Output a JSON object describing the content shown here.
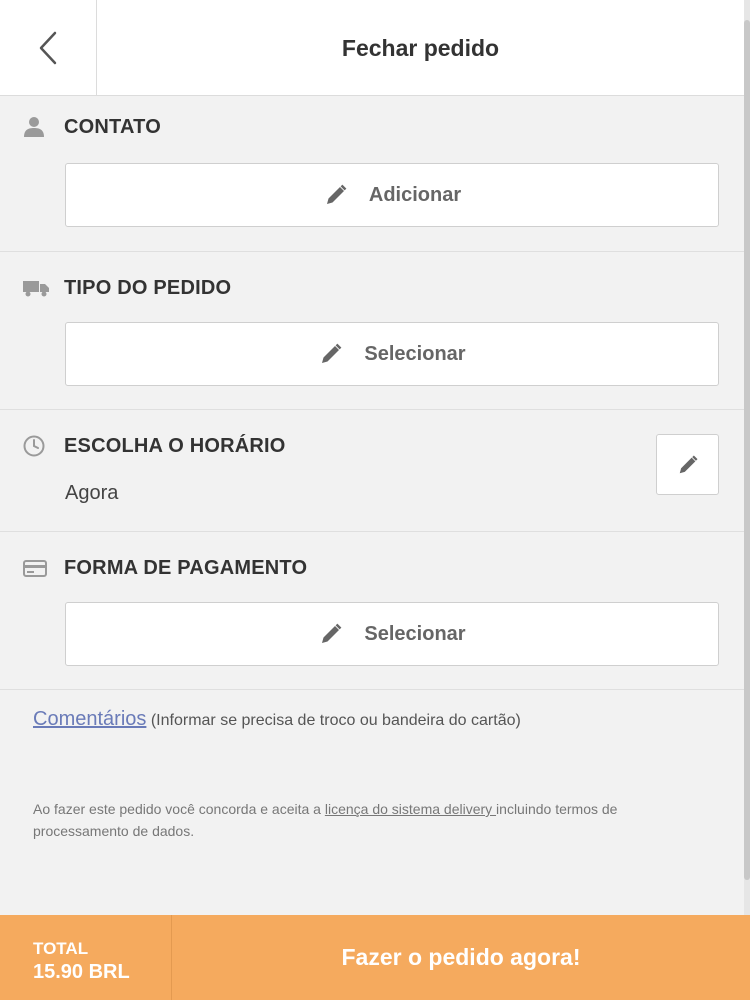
{
  "header": {
    "title": "Fechar pedido",
    "back_icon": "chevron-left-icon"
  },
  "sections": {
    "contact": {
      "title": "CONTATO",
      "icon": "user-icon",
      "button_label": "Adicionar"
    },
    "order_type": {
      "title": "TIPO DO PEDIDO",
      "icon": "truck-icon",
      "button_label": "Selecionar"
    },
    "time": {
      "title": "ESCOLHA O HORÁRIO",
      "icon": "clock-icon",
      "value": "Agora"
    },
    "payment": {
      "title": "FORMA DE PAGAMENTO",
      "icon": "credit-card-icon",
      "button_label": "Selecionar"
    }
  },
  "comments": {
    "link_label": "Comentários",
    "hint": "(Informar se precisa de troco ou bandeira do cartão)"
  },
  "terms": {
    "prefix": "Ao fazer este pedido você concorda e aceita a ",
    "link_label": "licença do sistema delivery ",
    "suffix": "incluindo termos de processamento de dados."
  },
  "footer": {
    "total_label": "TOTAL",
    "total_value": "15.90 BRL",
    "order_button_label": "Fazer o pedido agora!"
  },
  "colors": {
    "accent": "#f5aa5e",
    "link": "#6a7bb8",
    "background": "#f2f2f2"
  }
}
